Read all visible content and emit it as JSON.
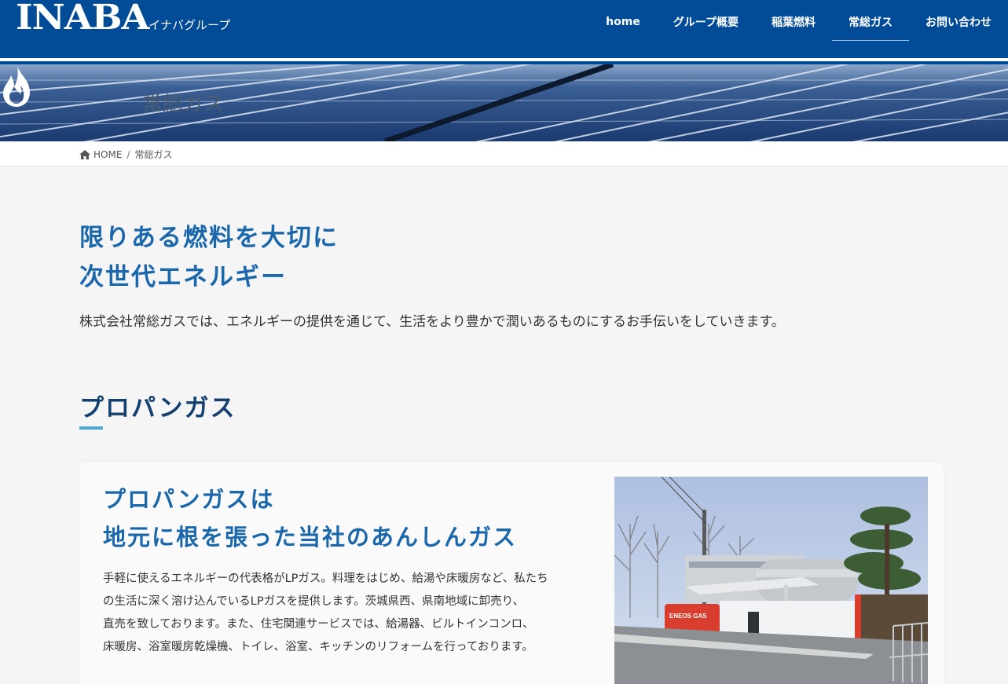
{
  "header": {
    "logo_main": "INABA",
    "logo_sub": "イナバグループ",
    "nav": [
      {
        "label": "home"
      },
      {
        "label": "グループ概要"
      },
      {
        "label": "稲葉燃料"
      },
      {
        "label": "常総ガス",
        "active": true
      },
      {
        "label": "お問い合わせ"
      }
    ]
  },
  "banner": {
    "icon": "flame-icon",
    "title": "常総ガス"
  },
  "breadcrumb": {
    "home_icon": "home-icon",
    "home": "HOME",
    "separator": "/",
    "current": "常総ガス"
  },
  "intro": {
    "title_line1": "限りある燃料を大切に",
    "title_line2": "次世代エネルギー",
    "text": "株式会社常総ガスでは、エネルギーの提供を通じて、生活をより豊かで潤いあるものにするお手伝いをしていきます。"
  },
  "section": {
    "heading": "プロパンガス"
  },
  "card": {
    "title_line1": "プロパンガスは",
    "title_line2": "地元に根を張った当社のあんしんガス",
    "text_lines": [
      "手軽に使えるエネルギーの代表格がLPガス。料理をはじめ、給湯や床暖房など、私たち",
      "の生活に深く溶け込んでいるLPガスを提供します。茨城県西、県南地域に卸売り、",
      "直売を致しております。また、住宅関連サービスでは、給湯器、ビルトインコンロ、",
      "床暖房、浴室暖房乾燥機、トイレ、浴室、キッチンのリフォームを行っております。"
    ],
    "photo_sign": "ENEOS GAS"
  },
  "colors": {
    "header_bg": "#014b97",
    "title_blue": "#1b67ac",
    "heading_navy": "#14406e",
    "accent_underline": "#4aa9d4",
    "page_bg": "#f5f5f5"
  }
}
